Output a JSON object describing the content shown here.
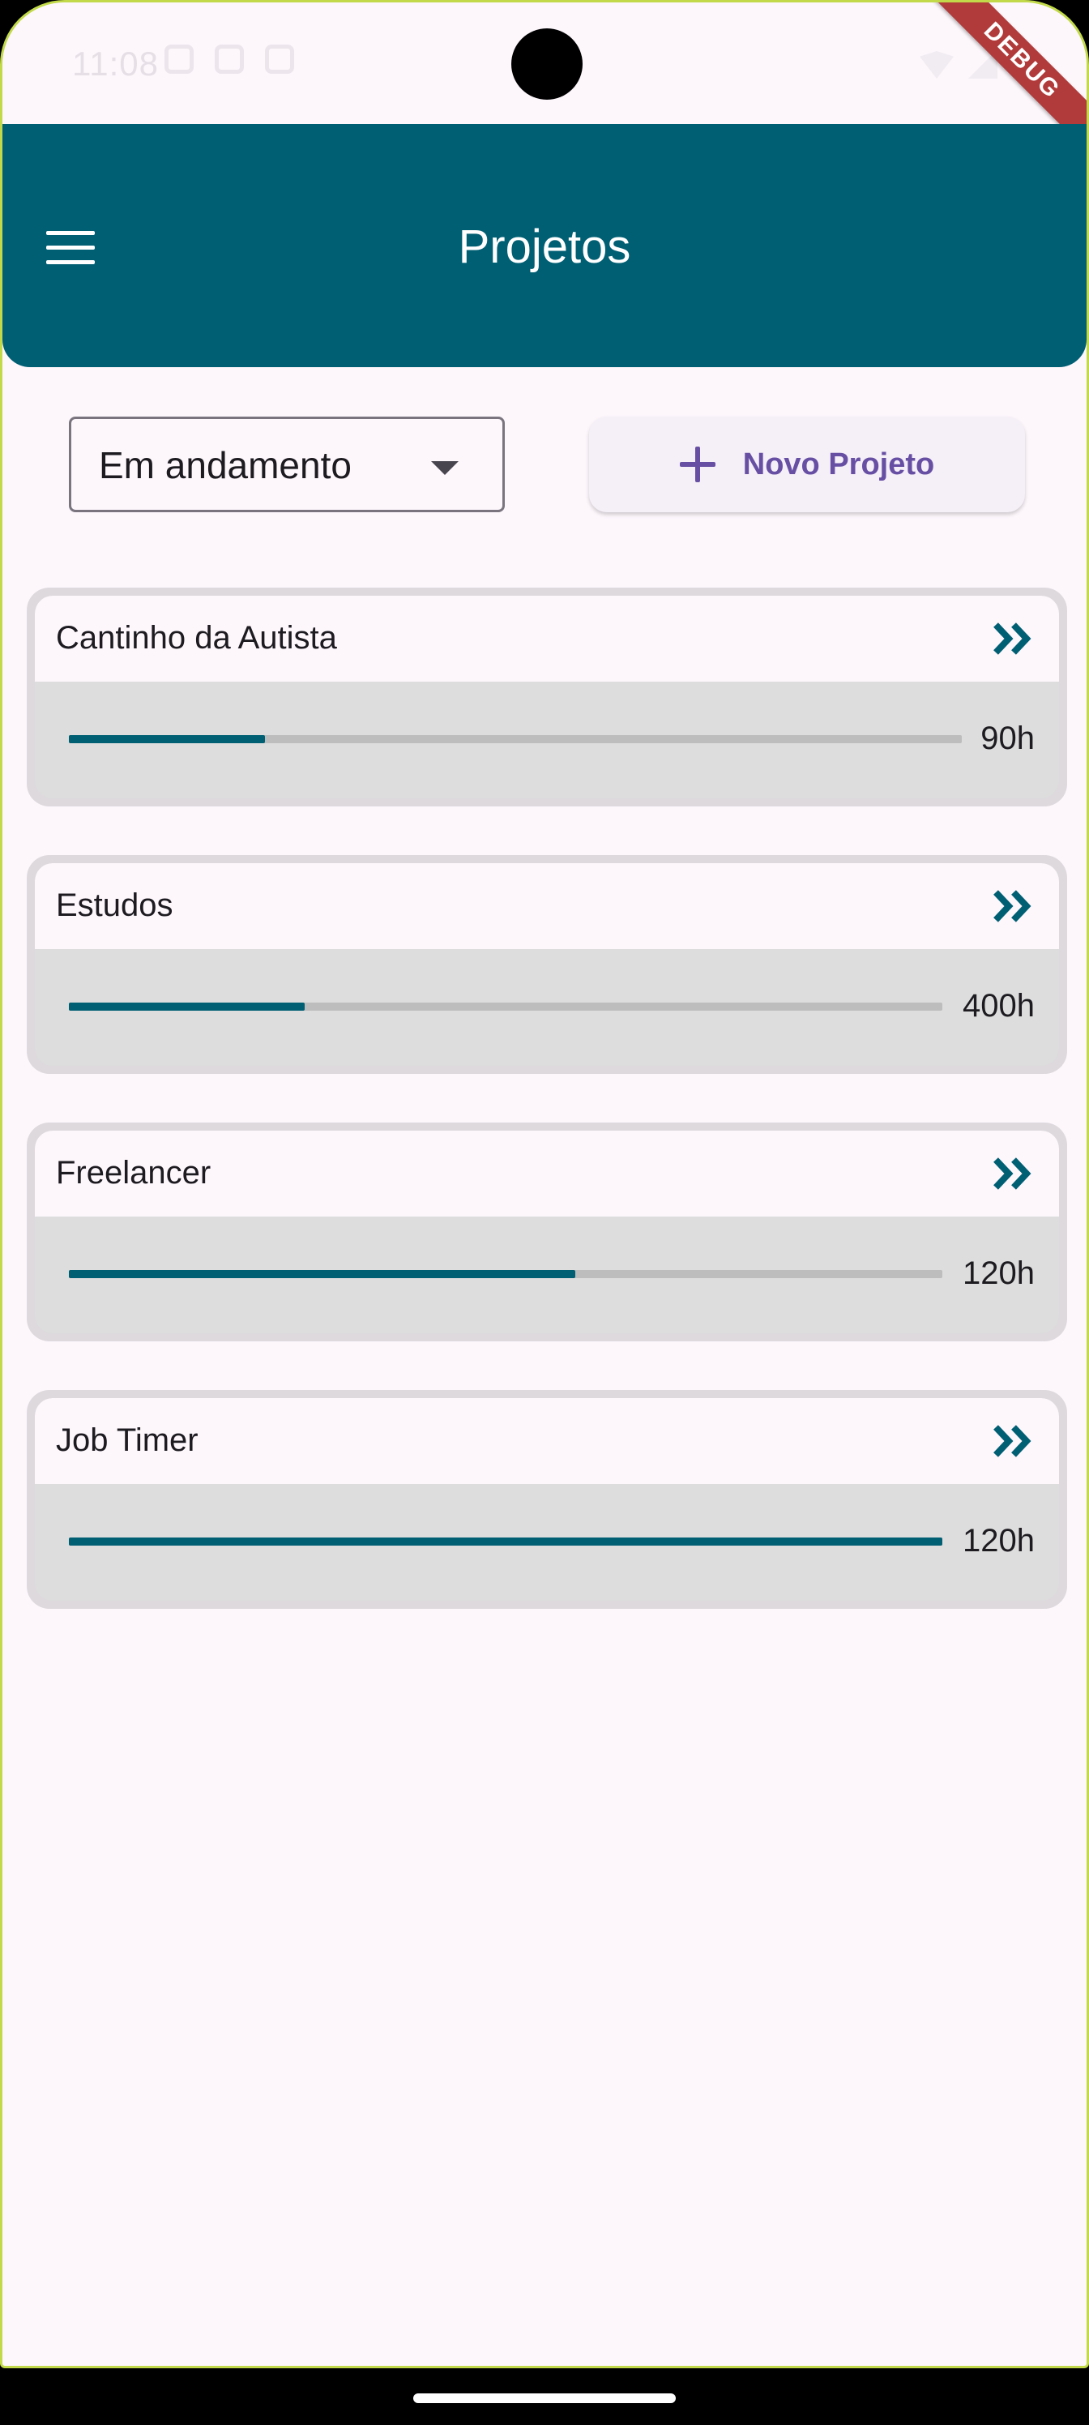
{
  "status_bar": {
    "time": "11:08"
  },
  "debug_banner": {
    "label": "DEBUG"
  },
  "app_bar": {
    "title": "Projetos",
    "menu_icon": "menu-icon"
  },
  "filter": {
    "selected": "Em andamento"
  },
  "new_project": {
    "label": "Novo Projeto",
    "icon": "plus-icon"
  },
  "projects": [
    {
      "name": "Cantinho da Autista",
      "hours": "90h",
      "progress": 0.22
    },
    {
      "name": "Estudos",
      "hours": "400h",
      "progress": 0.27
    },
    {
      "name": "Freelancer",
      "hours": "120h",
      "progress": 0.58
    },
    {
      "name": "Job Timer",
      "hours": "120h",
      "progress": 1.0
    }
  ],
  "colors": {
    "primary": "#005f73",
    "accent_purple": "#6750a4",
    "background": "#fdf7fc",
    "card": "#dddddd",
    "track": "#bdbdbd"
  }
}
